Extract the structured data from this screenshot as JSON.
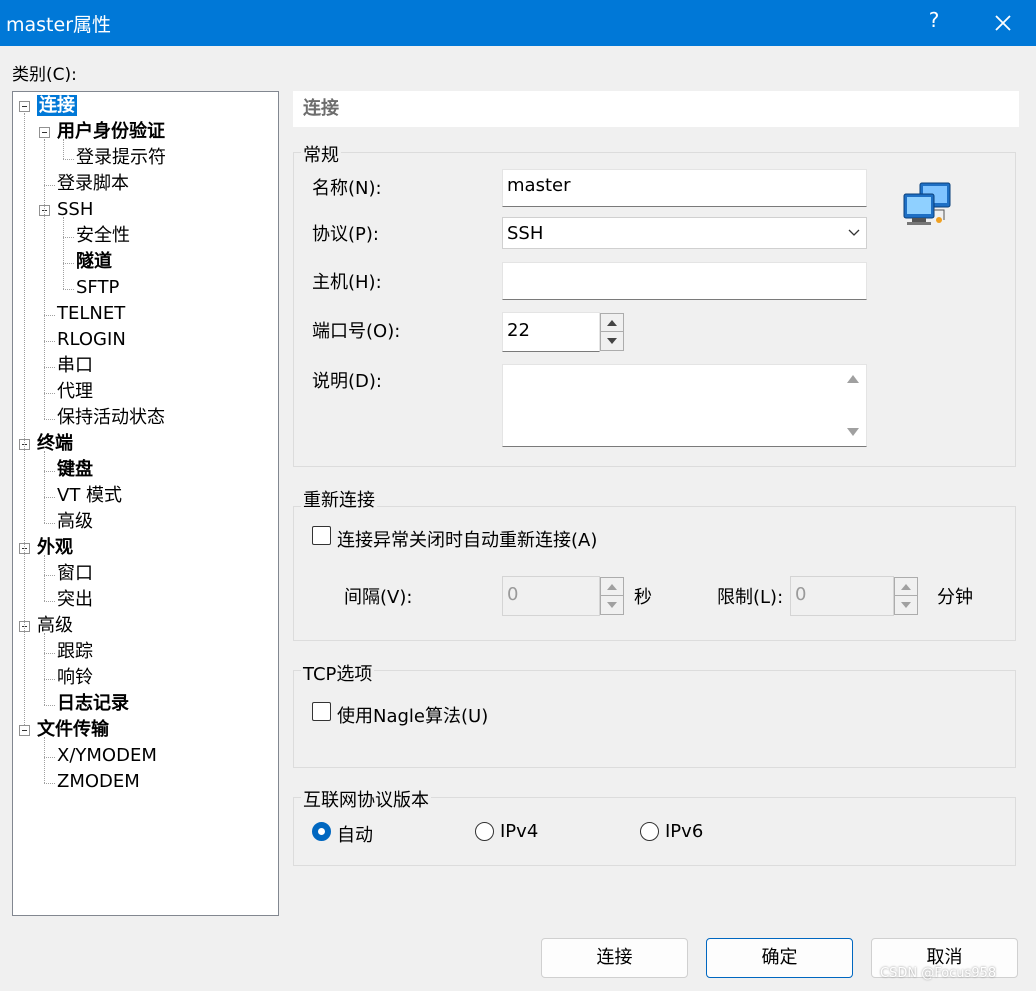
{
  "window": {
    "title": "master属性",
    "help": "?"
  },
  "category_label": "类别(C):",
  "tree": [
    {
      "label": "连接",
      "level": 0,
      "bold": true,
      "expander": true,
      "selected": true
    },
    {
      "label": "用户身份验证",
      "level": 1,
      "bold": true,
      "expander": true
    },
    {
      "label": "登录提示符",
      "level": 2
    },
    {
      "label": "登录脚本",
      "level": 1
    },
    {
      "label": "SSH",
      "level": 1,
      "expander": true
    },
    {
      "label": "安全性",
      "level": 2
    },
    {
      "label": "隧道",
      "level": 2,
      "bold": true
    },
    {
      "label": "SFTP",
      "level": 2
    },
    {
      "label": "TELNET",
      "level": 1
    },
    {
      "label": "RLOGIN",
      "level": 1
    },
    {
      "label": "串口",
      "level": 1
    },
    {
      "label": "代理",
      "level": 1
    },
    {
      "label": "保持活动状态",
      "level": 1
    },
    {
      "label": "终端",
      "level": 0,
      "bold": true,
      "expander": true
    },
    {
      "label": "键盘",
      "level": 1,
      "bold": true
    },
    {
      "label": "VT 模式",
      "level": 1
    },
    {
      "label": "高级",
      "level": 1
    },
    {
      "label": "外观",
      "level": 0,
      "bold": true,
      "expander": true
    },
    {
      "label": "窗口",
      "level": 1
    },
    {
      "label": "突出",
      "level": 1
    },
    {
      "label": "高级",
      "level": 0,
      "expander": true
    },
    {
      "label": "跟踪",
      "level": 1
    },
    {
      "label": "响铃",
      "level": 1
    },
    {
      "label": "日志记录",
      "level": 1,
      "bold": true
    },
    {
      "label": "文件传输",
      "level": 0,
      "bold": true,
      "expander": true
    },
    {
      "label": "X/YMODEM",
      "level": 1
    },
    {
      "label": "ZMODEM",
      "level": 1
    }
  ],
  "section_title": "连接",
  "general": {
    "title": "常规",
    "name_label": "名称(N):",
    "name_value": "master",
    "protocol_label": "协议(P):",
    "protocol_value": "SSH",
    "host_label": "主机(H):",
    "host_value": "",
    "port_label": "端口号(O):",
    "port_value": "22",
    "desc_label": "说明(D):",
    "desc_value": ""
  },
  "reconnect": {
    "title": "重新连接",
    "checkbox_label": "连接异常关闭时自动重新连接(A)",
    "interval_label": "间隔(V):",
    "interval_value": "0",
    "interval_unit": "秒",
    "limit_label": "限制(L):",
    "limit_value": "0",
    "limit_unit": "分钟"
  },
  "tcp": {
    "title": "TCP选项",
    "nagle_label": "使用Nagle算法(U)"
  },
  "ip_version": {
    "title": "互联网协议版本",
    "options": [
      "自动",
      "IPv4",
      "IPv6"
    ],
    "selected": "自动"
  },
  "buttons": {
    "connect": "连接",
    "ok": "确定",
    "cancel": "取消"
  },
  "watermark": "CSDN @Focus958"
}
